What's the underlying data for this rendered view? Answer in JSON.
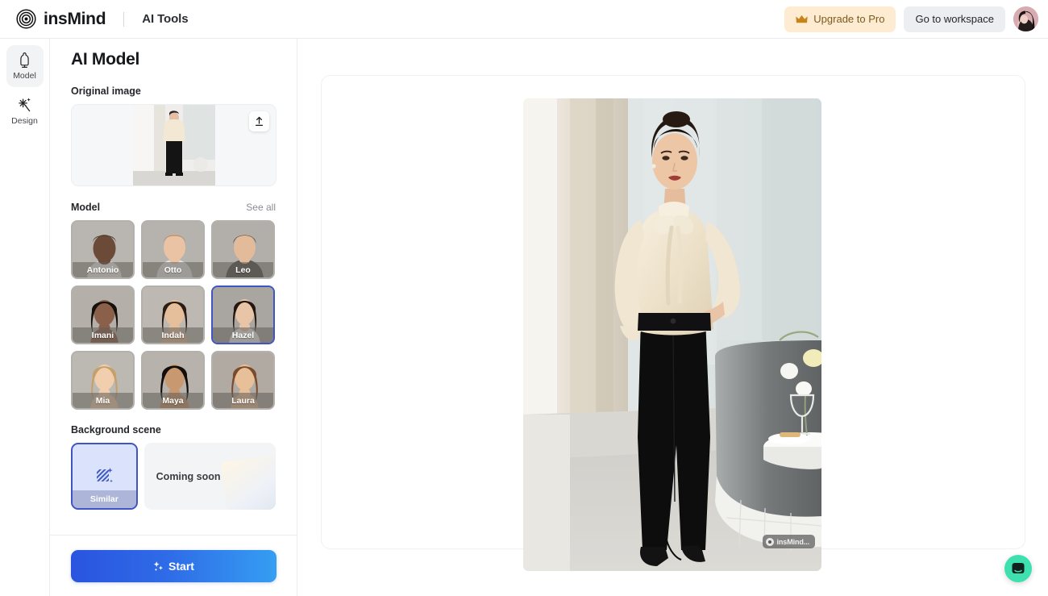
{
  "header": {
    "brand_name": "insMind",
    "brand_sub": "AI Tools",
    "logo_icon": "insmind-spiral-logo",
    "upgrade_label": "Upgrade to Pro",
    "upgrade_icon": "crown-icon",
    "upgrade_bg": "#fdecd2",
    "upgrade_color": "#7d5a1c",
    "workspace_label": "Go to workspace",
    "avatar_icon": "user-avatar"
  },
  "rail": {
    "items": [
      {
        "label": "Model",
        "icon": "dress-mannequin-icon",
        "active": true
      },
      {
        "label": "Design",
        "icon": "magic-wand-sparkle-icon",
        "active": false
      }
    ]
  },
  "panel": {
    "title": "AI Model",
    "original": {
      "label": "Original image",
      "upload_icon": "upload-arrow-icon"
    },
    "model": {
      "label": "Model",
      "see_all": "See all",
      "items": [
        {
          "name": "Antonio",
          "selected": false
        },
        {
          "name": "Otto",
          "selected": false
        },
        {
          "name": "Leo",
          "selected": false
        },
        {
          "name": "Imani",
          "selected": false
        },
        {
          "name": "Indah",
          "selected": false
        },
        {
          "name": "Hazel",
          "selected": true
        },
        {
          "name": "Mia",
          "selected": false
        },
        {
          "name": "Maya",
          "selected": false
        },
        {
          "name": "Laura",
          "selected": false
        }
      ]
    },
    "background": {
      "label": "Background scene",
      "similar_label": "Similar",
      "similar_icon": "diagonal-stripes-sparkle-icon",
      "coming_soon_label": "Coming soon"
    },
    "start_label": "Start",
    "start_icon": "sparkle-icon",
    "selected_accent": "#4055c4"
  },
  "canvas": {
    "watermark_text": "insMind...",
    "watermark_icon": "insmind-logo-small"
  },
  "chat": {
    "icon": "chat-bubble-icon",
    "color": "#3fe0b0"
  }
}
